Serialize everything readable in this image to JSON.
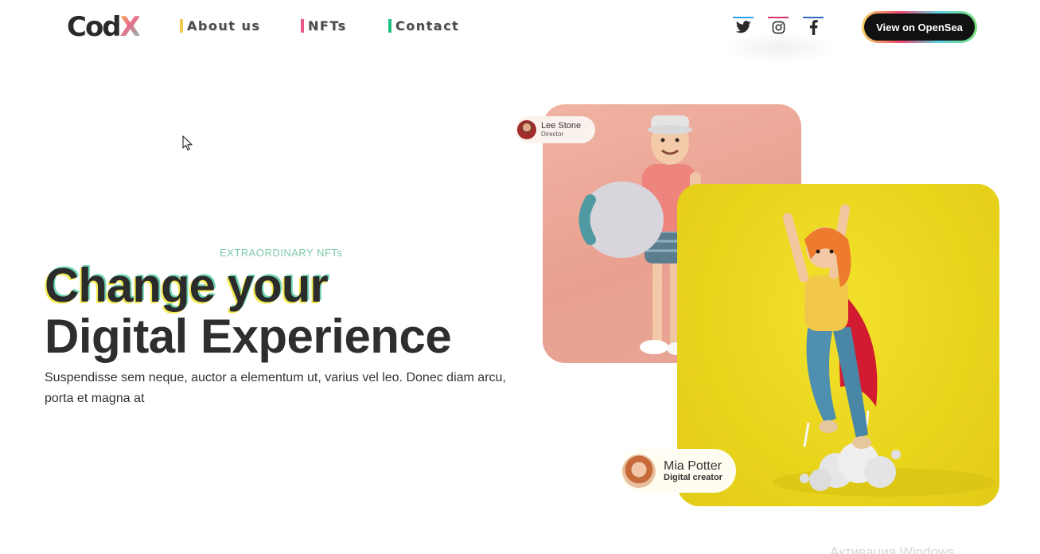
{
  "brand": {
    "logo_main": "Cod",
    "logo_accent": "X"
  },
  "nav": {
    "links": [
      {
        "label": "About us",
        "accent": "#f2c94c"
      },
      {
        "label": "NFTs",
        "accent": "#e8588a"
      },
      {
        "label": "Contact",
        "accent": "#1fbf82"
      }
    ],
    "social": [
      {
        "icon": "twitter-icon",
        "accent": "#2aa3e8"
      },
      {
        "icon": "instagram-icon",
        "accent": "#d6336c"
      },
      {
        "icon": "facebook-icon",
        "accent": "#2f6cc4"
      }
    ],
    "cta_label": "View on OpenSea"
  },
  "hero": {
    "eyebrow": "EXTRAORDINARY NFTs",
    "title_line1": "Change your",
    "title_line2": "Digital Experience",
    "description": "Suspendisse sem neque, auctor a elementum ut, varius vel leo. Donec diam arcu, porta et magna at"
  },
  "gallery": {
    "cards": [
      {
        "name": "pink-card",
        "background": "#eca595"
      },
      {
        "name": "yellow-card",
        "background": "#e9d41c"
      }
    ],
    "profiles": [
      {
        "name": "Lee Stone",
        "role": "Director"
      },
      {
        "name": "Mia Potter",
        "role": "Digital creator"
      }
    ]
  },
  "overlay": {
    "watermark": "Активация Windows"
  }
}
